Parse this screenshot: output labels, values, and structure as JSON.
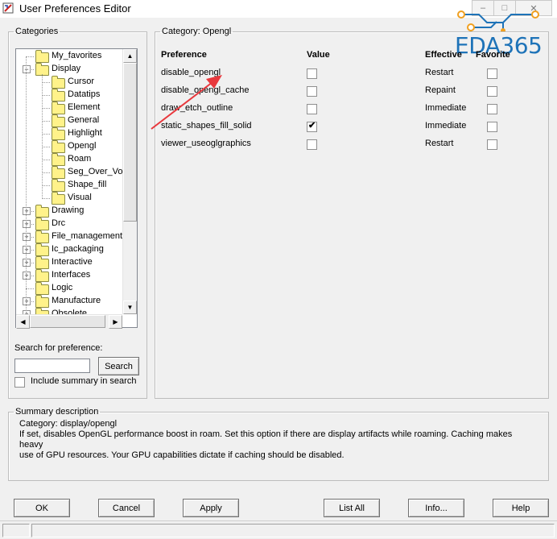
{
  "window": {
    "title": "User Preferences Editor",
    "min_glyph": "–",
    "max_glyph": "□",
    "close_glyph": "✕"
  },
  "logo": {
    "text": "EDA365"
  },
  "categories": {
    "legend": "Categories",
    "items": [
      {
        "label": "My_favorites",
        "expander": ""
      },
      {
        "label": "Display",
        "expander": "−"
      },
      {
        "label": "Cursor",
        "expander": ""
      },
      {
        "label": "Datatips",
        "expander": ""
      },
      {
        "label": "Element",
        "expander": ""
      },
      {
        "label": "General",
        "expander": ""
      },
      {
        "label": "Highlight",
        "expander": ""
      },
      {
        "label": "Opengl",
        "expander": ""
      },
      {
        "label": "Roam",
        "expander": ""
      },
      {
        "label": "Seg_Over_Voi",
        "expander": ""
      },
      {
        "label": "Shape_fill",
        "expander": ""
      },
      {
        "label": "Visual",
        "expander": ""
      },
      {
        "label": "Drawing",
        "expander": "+"
      },
      {
        "label": "Drc",
        "expander": "+"
      },
      {
        "label": "File_management",
        "expander": "+"
      },
      {
        "label": "Ic_packaging",
        "expander": "+"
      },
      {
        "label": "Interactive",
        "expander": "+"
      },
      {
        "label": "Interfaces",
        "expander": "+"
      },
      {
        "label": "Logic",
        "expander": ""
      },
      {
        "label": "Manufacture",
        "expander": "+"
      },
      {
        "label": "Obsolete",
        "expander": "+"
      }
    ],
    "scroll_up": "▲",
    "scroll_down": "▼",
    "scroll_left": "◀",
    "scroll_right": "▶"
  },
  "search": {
    "label": "Search for preference:",
    "value": "",
    "placeholder": "",
    "button": "Search",
    "include_summary": "Include summary in search",
    "include_summary_checked": false
  },
  "category_panel": {
    "legend": "Category:  Opengl",
    "headers": {
      "preference": "Preference",
      "value": "Value",
      "effective": "Effective",
      "favorite": "Favorite"
    },
    "rows": [
      {
        "name": "disable_opengl",
        "value_checked": false,
        "effective": "Restart",
        "favorite": false
      },
      {
        "name": "disable_opengl_cache",
        "value_checked": false,
        "effective": "Repaint",
        "favorite": false
      },
      {
        "name": "draw_etch_outline",
        "value_checked": false,
        "effective": "Immediate",
        "favorite": false
      },
      {
        "name": "static_shapes_fill_solid",
        "value_checked": true,
        "effective": "Immediate",
        "favorite": false
      },
      {
        "name": "viewer_useoglgraphics",
        "value_checked": false,
        "effective": "Restart",
        "favorite": false
      }
    ],
    "check_glyph": "✔"
  },
  "summary": {
    "legend": "Summary description",
    "category_line": "Category: display/opengl",
    "text_line1": "If set, disables OpenGL performance boost in roam. Set this option if there are display artifacts while roaming. Caching makes heavy",
    "text_line2": "use of GPU resources. Your GPU capabilities dictate if caching should be disabled."
  },
  "buttons": {
    "ok": "OK",
    "cancel": "Cancel",
    "apply": "Apply",
    "list_all": "List All",
    "info": "Info...",
    "help": "Help"
  },
  "colors": {
    "annotation_arrow": "#e8383d",
    "logo_blue": "#1e73b8",
    "logo_orange": "#f0a020"
  }
}
